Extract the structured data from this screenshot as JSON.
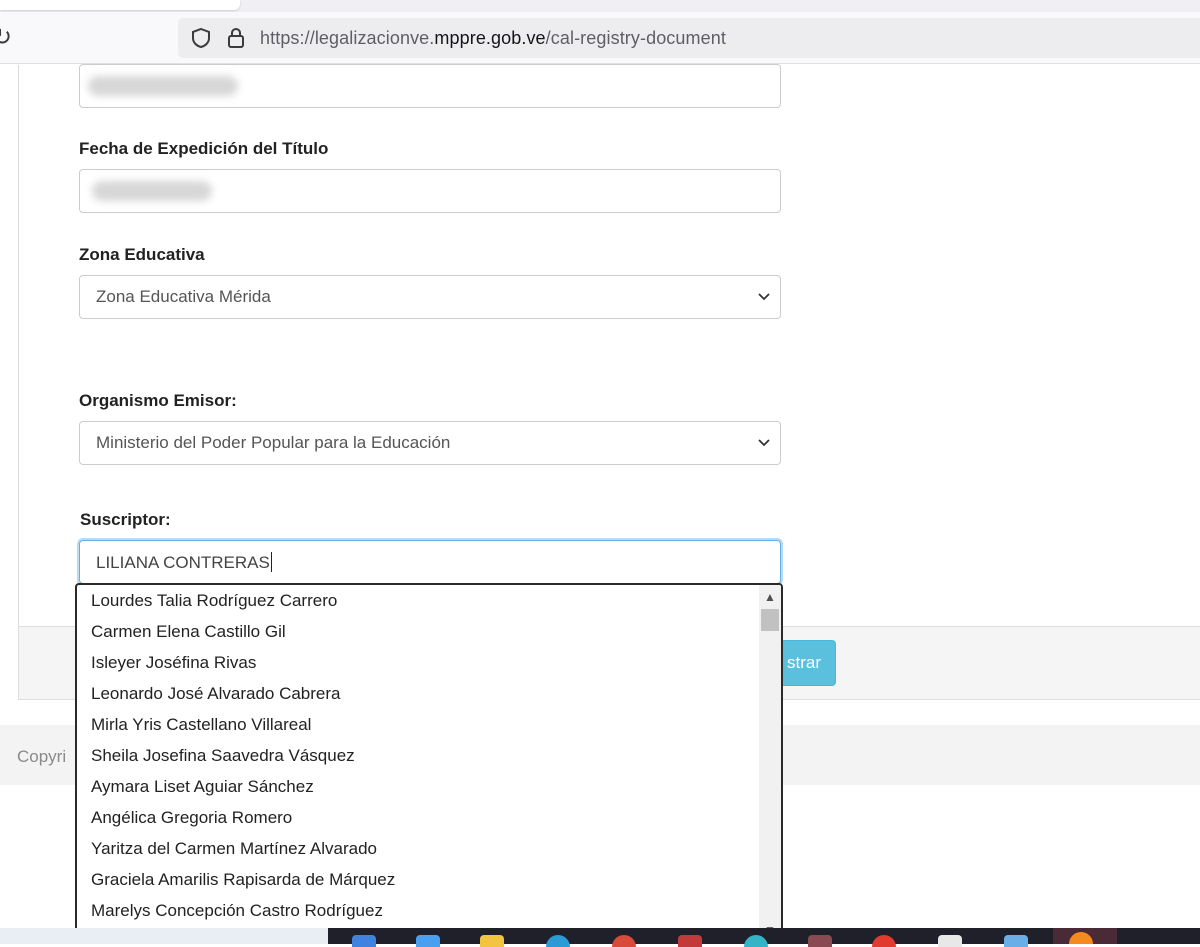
{
  "browser": {
    "url_prefix": "https://legalizacionve.",
    "url_host": "mppre.gob.ve",
    "url_path": "/cal-registry-document"
  },
  "form": {
    "fecha_label": "Fecha de Expedición del Título",
    "zona_label": "Zona Educativa",
    "zona_value": "Zona Educativa Mérida",
    "organismo_label": "Organismo Emisor:",
    "organismo_value": "Ministerio del Poder Popular para la Educación",
    "suscriptor_label": "Suscriptor:",
    "suscriptor_value": "LILIANA CONTRERAS"
  },
  "autocomplete": {
    "options": [
      "Lourdes Talia Rodríguez Carrero",
      "Carmen Elena Castillo Gil",
      "Isleyer Joséfina Rivas",
      "Leonardo José Alvarado Cabrera",
      "Mirla Yris Castellano Villareal",
      "Sheila Josefina Saavedra Vásquez",
      "Aymara Liset Aguiar Sánchez",
      "Angélica Gregoria Romero",
      "Yaritza del Carmen Martínez Alvarado",
      "Graciela Amarilis Rapisarda de Márquez",
      "Marelys Concepción Castro Rodríguez"
    ]
  },
  "actions": {
    "registrar_visible": "strar"
  },
  "footer": {
    "copyright_visible": "Copyri"
  },
  "colors": {
    "button_info": "#5bc0de",
    "focus_border": "#66afe9"
  }
}
